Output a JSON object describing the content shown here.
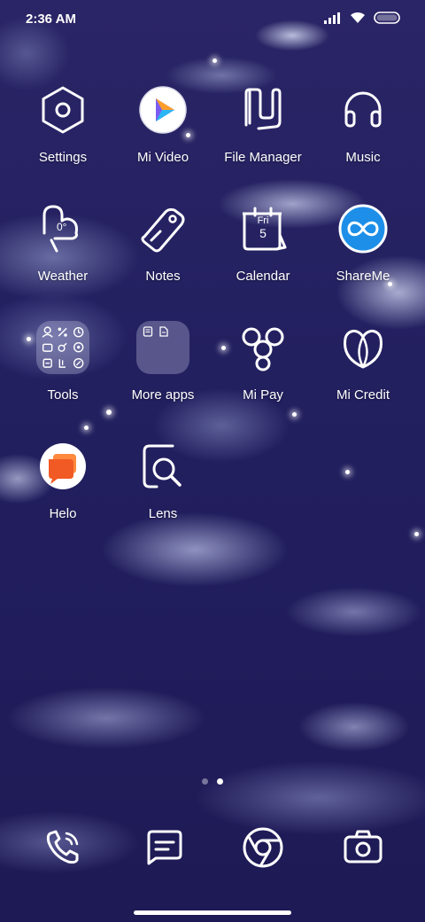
{
  "status_bar": {
    "time": "2:36 AM",
    "icons": [
      "signal-icon",
      "wifi-icon",
      "battery-icon"
    ]
  },
  "apps": [
    {
      "label": "Settings",
      "icon": "settings-icon"
    },
    {
      "label": "Mi Video",
      "icon": "mi-video-icon"
    },
    {
      "label": "File Manager",
      "icon": "file-manager-icon"
    },
    {
      "label": "Music",
      "icon": "headphones-icon"
    },
    {
      "label": "Weather",
      "icon": "weather-icon",
      "badge": "0°"
    },
    {
      "label": "Notes",
      "icon": "notes-tag-icon"
    },
    {
      "label": "Calendar",
      "icon": "calendar-icon",
      "day": "Fri",
      "date": "5"
    },
    {
      "label": "ShareMe",
      "icon": "shareme-icon"
    },
    {
      "label": "Tools",
      "icon": "tools-folder-icon"
    },
    {
      "label": "More apps",
      "icon": "more-apps-folder-icon"
    },
    {
      "label": "Mi Pay",
      "icon": "mi-pay-icon"
    },
    {
      "label": "Mi Credit",
      "icon": "mi-credit-icon"
    },
    {
      "label": "Helo",
      "icon": "helo-icon"
    },
    {
      "label": "Lens",
      "icon": "lens-icon"
    }
  ],
  "page_indicator": {
    "count": 2,
    "active": 2
  },
  "dock": [
    {
      "name": "phone-icon"
    },
    {
      "name": "messages-icon"
    },
    {
      "name": "browser-icon"
    },
    {
      "name": "camera-icon"
    }
  ],
  "colors": {
    "background": "#25215f",
    "shareme_blue": "#1e8fe8",
    "helo_orange": "#f15a24"
  }
}
